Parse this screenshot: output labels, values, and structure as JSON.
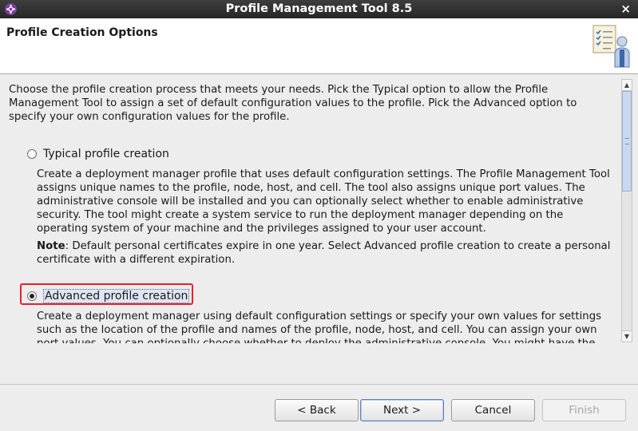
{
  "window": {
    "title": "Profile Management Tool 8.5",
    "close_glyph": "×"
  },
  "header": {
    "heading": "Profile Creation Options",
    "banner_icon": "checklist-user-icon"
  },
  "content": {
    "intro": "Choose the profile creation process that meets your needs. Pick the Typical option to allow the Profile Management Tool to assign a set of default configuration values to the profile. Pick the Advanced option to specify your own configuration values for the profile.",
    "options": [
      {
        "label": "Typical profile creation",
        "selected": false,
        "description": "Create a deployment manager profile that uses default configuration settings. The Profile Management Tool assigns unique names to the profile, node, host, and cell. The tool also assigns unique port values. The administrative console will be installed and you can optionally select whether to enable administrative security. The tool might create a system service to run the deployment manager depending on the operating system of your machine and the privileges assigned to your user account.",
        "note_label": "Note",
        "note_text": ": Default personal certificates expire in one year.  Select Advanced profile creation to create a personal certificate with a different expiration."
      },
      {
        "label": "Advanced profile creation",
        "selected": true,
        "description": "Create a deployment manager using default configuration settings or specify your own values for settings such as the location of the profile and names of the profile, node, host, and cell. You can assign your own port values. You can optionally choose whether to deploy the administrative console. You might have the"
      }
    ]
  },
  "buttons": {
    "back": "< Back",
    "next": "Next >",
    "cancel": "Cancel",
    "finish": "Finish"
  },
  "colors": {
    "highlight": "#e8202a",
    "titlebar": "#2e2e2e"
  }
}
